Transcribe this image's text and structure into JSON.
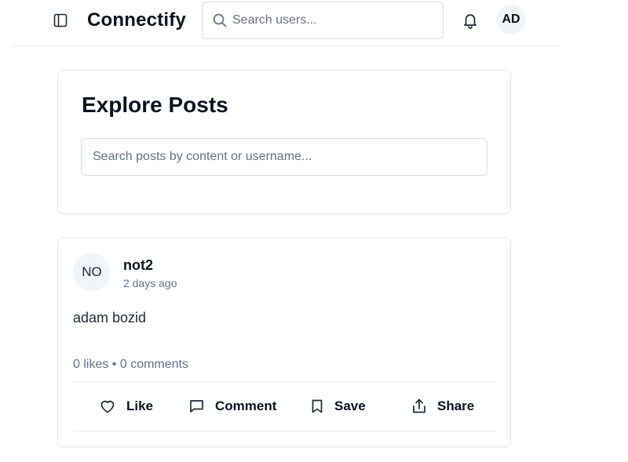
{
  "header": {
    "brand": "Connectify",
    "search_placeholder": "Search users...",
    "user_initials": "AD"
  },
  "explore": {
    "title": "Explore Posts",
    "search_placeholder": "Search posts by content or username..."
  },
  "posts": [
    {
      "avatar_initials": "NO",
      "author": "not2",
      "time": "2 days ago",
      "content": "adam bozid",
      "stats": "0 likes • 0 comments",
      "actions": {
        "like": "Like",
        "comment": "Comment",
        "save": "Save",
        "share": "Share"
      }
    }
  ],
  "icons": {
    "sidebar_toggle": "sidebar-toggle-icon",
    "search": "search-icon",
    "notifications": "bell-icon",
    "like": "heart-icon",
    "comment": "message-square-icon",
    "save": "bookmark-icon",
    "share": "share-icon"
  }
}
